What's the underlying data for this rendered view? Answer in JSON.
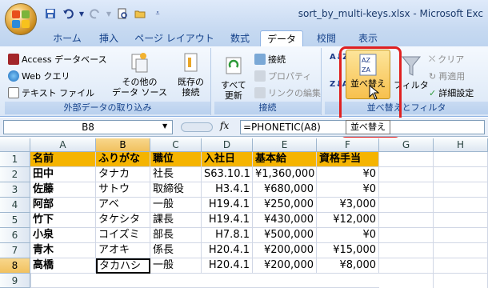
{
  "window": {
    "title": "sort_by_multi-keys.xlsx - Microsoft Exc"
  },
  "quick_access": [
    "save-icon",
    "undo-icon",
    "redo-icon",
    "print-preview-icon",
    "open-icon",
    "customize-icon"
  ],
  "tabs": [
    "ホーム",
    "挿入",
    "ページ レイアウト",
    "数式",
    "データ",
    "校閲",
    "表示"
  ],
  "active_tab": "データ",
  "ribbon": {
    "external": {
      "access": "Access データベース",
      "web": "Web クエリ",
      "text": "テキスト ファイル",
      "other_line1": "その他の",
      "other_line2": "データ ソース",
      "existing_line1": "既存の",
      "existing_line2": "接続",
      "label": "外部データの取り込み"
    },
    "connections": {
      "refresh_line1": "すべて",
      "refresh_line2": "更新",
      "connections": "接続",
      "properties": "プロパティ",
      "edit_links": "リンクの編集",
      "label": "接続"
    },
    "sort": {
      "sort_btn": "並べ替え",
      "filter_btn": "フィルタ",
      "clear": "クリア",
      "reapply": "再適用",
      "advanced": "詳細設定",
      "label": "並べ替えとフィルタ"
    }
  },
  "formula_bar": {
    "name_box": "B8",
    "fx": "fx",
    "formula": "=PHONETIC(A8)"
  },
  "tooltip": "並べ替え",
  "columns": [
    "A",
    "B",
    "C",
    "D",
    "E",
    "F",
    "G",
    "H"
  ],
  "rows": [
    "1",
    "2",
    "3",
    "4",
    "5",
    "6",
    "7",
    "8",
    "9"
  ],
  "table": {
    "headers": [
      "名前",
      "ふりがな",
      "職位",
      "入社日",
      "基本給",
      "資格手当"
    ],
    "data": [
      [
        "田中",
        "タナカ",
        "社長",
        "S63.10.1",
        "¥1,360,000",
        "¥0"
      ],
      [
        "佐藤",
        "サトウ",
        "取締役",
        "H3.4.1",
        "¥680,000",
        "¥0"
      ],
      [
        "阿部",
        "アベ",
        "一般",
        "H19.4.1",
        "¥250,000",
        "¥3,000"
      ],
      [
        "竹下",
        "タケシタ",
        "課長",
        "H19.4.1",
        "¥430,000",
        "¥12,000"
      ],
      [
        "小泉",
        "コイズミ",
        "部長",
        "H7.8.1",
        "¥500,000",
        "¥0"
      ],
      [
        "青木",
        "アオキ",
        "係長",
        "H20.4.1",
        "¥200,000",
        "¥15,000"
      ],
      [
        "高橋",
        "タカハシ",
        "一般",
        "H20.4.1",
        "¥200,000",
        "¥8,000"
      ]
    ]
  },
  "colors": {
    "header_fill": "#f5b400",
    "callout": "#e02020",
    "ribbon_text": "#15428b"
  }
}
